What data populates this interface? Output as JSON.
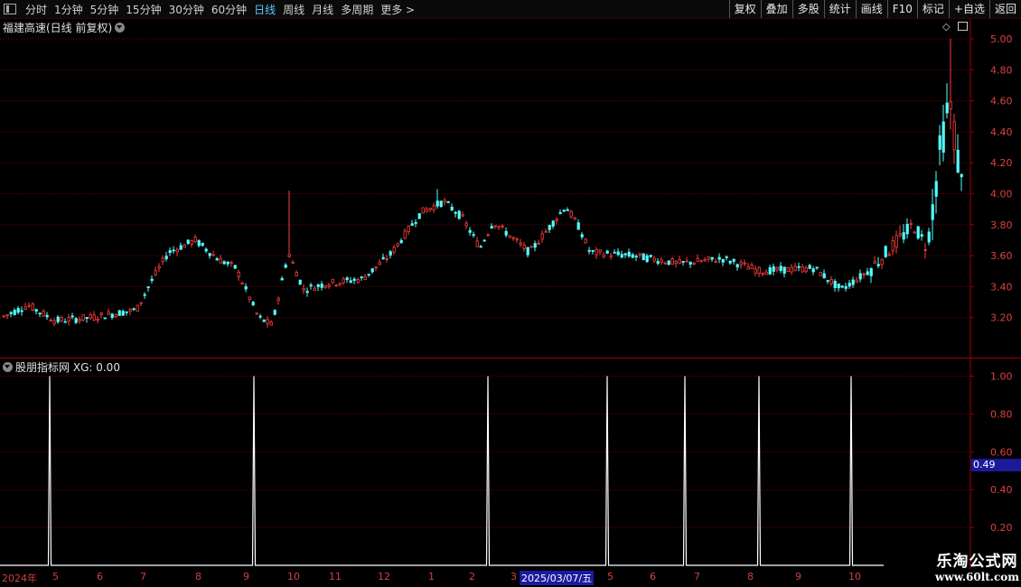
{
  "toolbar": {
    "periods": [
      "分时",
      "1分钟",
      "5分钟",
      "15分钟",
      "30分钟",
      "60分钟",
      "日线",
      "周线",
      "月线",
      "多周期",
      "更多 >"
    ],
    "active_period": "日线",
    "buttons": [
      "复权",
      "叠加",
      "多股",
      "统计",
      "画线",
      "F10",
      "标记",
      "+自选",
      "返回"
    ]
  },
  "main_panel": {
    "title": "福建高速(日线 前复权)",
    "y_ticks": [
      "5.00",
      "4.80",
      "4.60",
      "4.40",
      "4.20",
      "4.00",
      "3.80",
      "3.60",
      "3.40",
      "3.20"
    ],
    "ylim": [
      3.05,
      5.05
    ],
    "colors": {
      "up": "#ff3c3c",
      "down": "#54ffff",
      "grid": "#7a0000",
      "axis": "#a00000"
    }
  },
  "indicator_panel": {
    "title": "股朋指标网",
    "metric_label": "XG:",
    "metric_value": "0.00",
    "y_ticks": [
      "1.00",
      "0.80",
      "0.60",
      "0.40",
      "0.20"
    ],
    "selected_value": "0.49"
  },
  "x_axis": {
    "labels": [
      "2024年",
      "5",
      "6",
      "7",
      "8",
      "9",
      "10",
      "11",
      "12",
      "1",
      "2",
      "3",
      "2025/03/07/五",
      "5",
      "6",
      "7",
      "8",
      "9",
      "10"
    ],
    "highlight": "2025/03/07/五"
  },
  "watermark": {
    "line1": "乐淘公式网",
    "line2": "www.60lt.com"
  }
}
